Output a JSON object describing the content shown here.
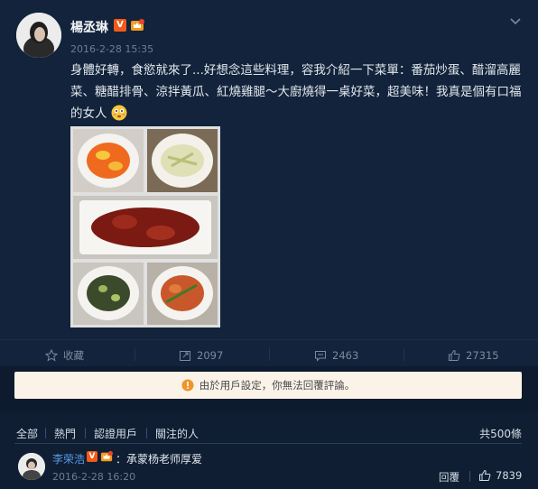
{
  "post": {
    "username": "楊丞琳",
    "verified_badge": "V",
    "timestamp": "2016-2-28 15:35",
    "text": "身體好轉，食慾就來了...好想念這些料理，容我介紹一下菜單：番茄炒蛋、醋溜高麗菜、糖醋排骨、涼拌黃瓜、紅燒雞腿～大廚燒得一桌好菜，超美味！我真是個有口福的女人"
  },
  "actions": {
    "favorite_label": "收藏",
    "repost_count": "2097",
    "comment_count": "2463",
    "like_count": "27315"
  },
  "notice": {
    "text": "由於用戶設定，你無法回覆評論。"
  },
  "comment_filters": {
    "items": [
      "全部",
      "熱門",
      "認證用戶",
      "關注的人"
    ],
    "total": "共500條"
  },
  "comment": {
    "username": "李荣浩",
    "verified_badge": "V",
    "text": "：承蒙杨老师厚爱",
    "timestamp": "2016-2-28 16:20",
    "reply_label": "回覆",
    "like_count": "7839"
  },
  "colors": {
    "background": "#0f1e33",
    "card": "#12233b",
    "verified_orange": "#f25a1a",
    "link_blue": "#5a9ae6",
    "notice_bg": "#fbf3e8"
  }
}
